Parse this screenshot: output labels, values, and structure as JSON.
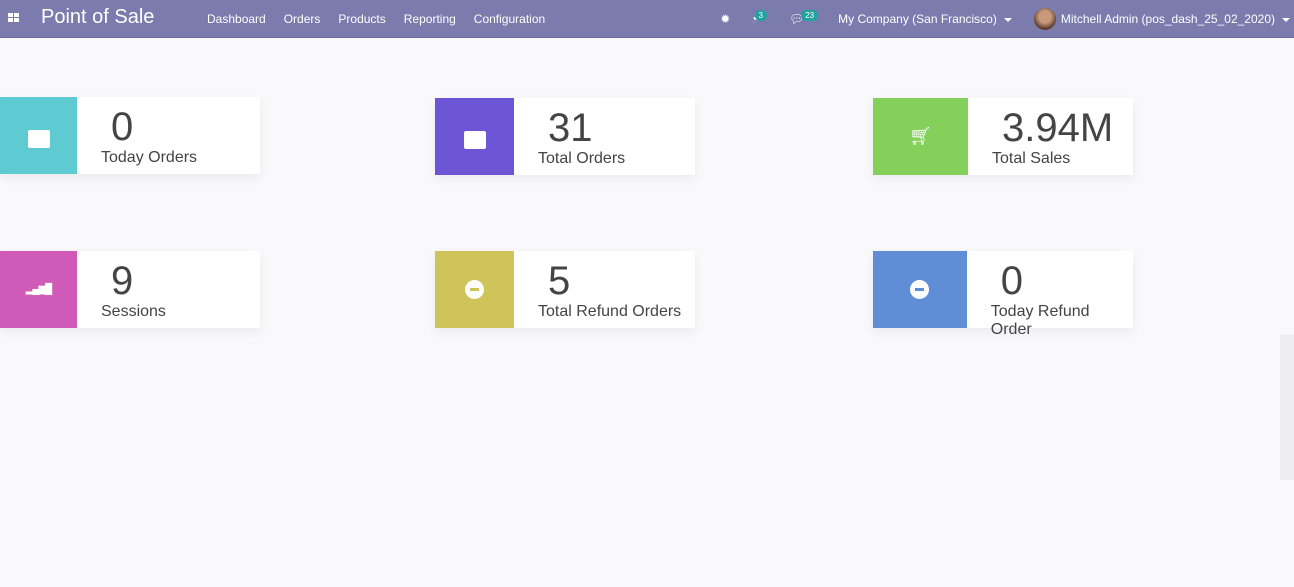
{
  "nav": {
    "title": "Point of Sale",
    "menu": [
      "Dashboard",
      "Orders",
      "Products",
      "Reporting",
      "Configuration"
    ],
    "activity_count": "3",
    "message_count": "23",
    "company": "My Company (San Francisco)",
    "user": "Mitchell Admin (pos_dash_25_02_2020)"
  },
  "cards": [
    {
      "value": "0",
      "label": "Today Orders",
      "color": "#5ecbd3",
      "icon": "shopping-bag-icon"
    },
    {
      "value": "31",
      "label": "Total Orders",
      "color": "#6c56d6",
      "icon": "shopping-bag-icon"
    },
    {
      "value": "3.94M",
      "label": "Total Sales",
      "color": "#84d05a",
      "icon": "shopping-cart-icon"
    },
    {
      "value": "9",
      "label": "Sessions",
      "color": "#d05ab8",
      "icon": "signal-icon"
    },
    {
      "value": "5",
      "label": "Total Refund Orders",
      "color": "#cfc45a",
      "icon": "minus-circle-icon"
    },
    {
      "value": "0",
      "label": "Today Refund Order",
      "color": "#5f8ed6",
      "icon": "minus-circle-icon"
    }
  ]
}
